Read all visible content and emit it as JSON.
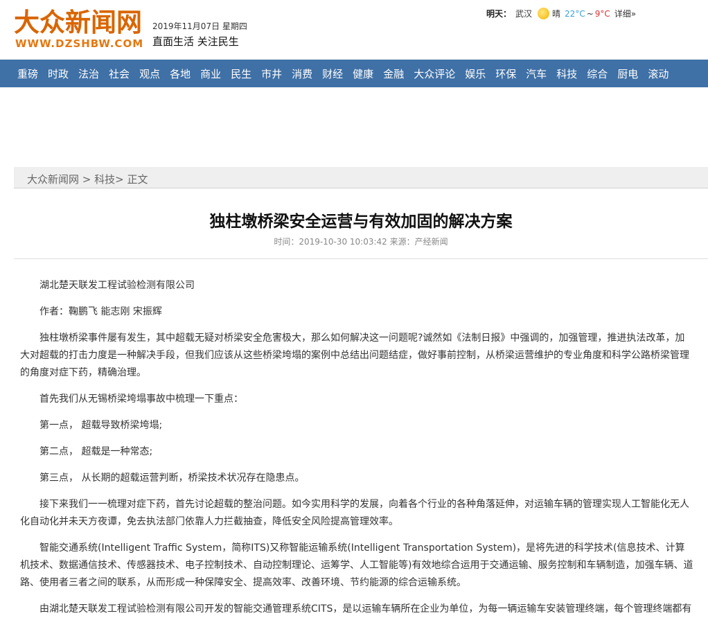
{
  "header": {
    "logo_cn": "大众新闻网",
    "logo_en": "WWW.DZSHBW.COM",
    "date": "2019年11月07日 星期四",
    "slogan": "直面生活 关注民生",
    "weather": {
      "label": "明天：",
      "city": "武汉",
      "condition": "晴",
      "high": "22°C",
      "sep": "~",
      "low": "9°C",
      "detail": "详细»"
    }
  },
  "nav": [
    "重磅",
    "时政",
    "法治",
    "社会",
    "观点",
    "各地",
    "商业",
    "民生",
    "市井",
    "消费",
    "财经",
    "健康",
    "金融",
    "大众评论",
    "娱乐",
    "环保",
    "汽车",
    "科技",
    "综合",
    "厨电",
    "滚动"
  ],
  "breadcrumb": "大众新闻网 > 科技> 正文",
  "article": {
    "title": "独柱墩桥梁安全运营与有效加固的解决方案",
    "meta": "时间：2019-10-30 10:03:42 来源：产经新闻",
    "paragraphs": [
      "湖北楚天联发工程试验检测有限公司",
      "作者：鞠鹏飞 能志刚 宋振辉",
      "独柱墩桥梁事件屡有发生，其中超载无疑对桥梁安全危害极大，那么如何解决这一问题呢?诚然如《法制日报》中强调的，加强管理，推进执法改革，加大对超载的打击力度是一种解决手段，但我们应该从这些桥梁垮塌的案例中总结出问题结症，做好事前控制，从桥梁运营维护的专业角度和科学公路桥梁管理的角度对症下药，精确治理。",
      "首先我们从无锡桥梁垮塌事故中梳理一下重点：",
      "第一点， 超载导致桥梁垮塌;",
      "第二点， 超载是一种常态;",
      "第三点， 从长期的超载运营判断，桥梁技术状况存在隐患点。",
      "接下来我们一一梳理对症下药，首先讨论超载的整治问题。如今实用科学的发展，向着各个行业的各种角落延伸，对运输车辆的管理实现人工智能化无人化自动化并未天方夜谭，免去执法部门依靠人力拦截抽查，降低安全风险提高管理效率。",
      "智能交通系统(Intelligent Traffic System，简称ITS)又称智能运输系统(Intelligent Transportation System)，是将先进的科学技术(信息技术、计算机技术、数据通信技术、传感器技术、电子控制技术、自动控制理论、运筹学、人工智能等)有效地综合运用于交通运输、服务控制和车辆制造，加强车辆、道路、使用者三者之间的联系，从而形成一种保障安全、提高效率、改善环境、节约能源的综合运输系统。",
      "由湖北楚天联发工程试验检测有限公司开发的智能交通管理系统CITS，是以运输车辆所在企业为单位，为每一辆运输车安装管理终端，每个管理终端都有"
    ]
  }
}
